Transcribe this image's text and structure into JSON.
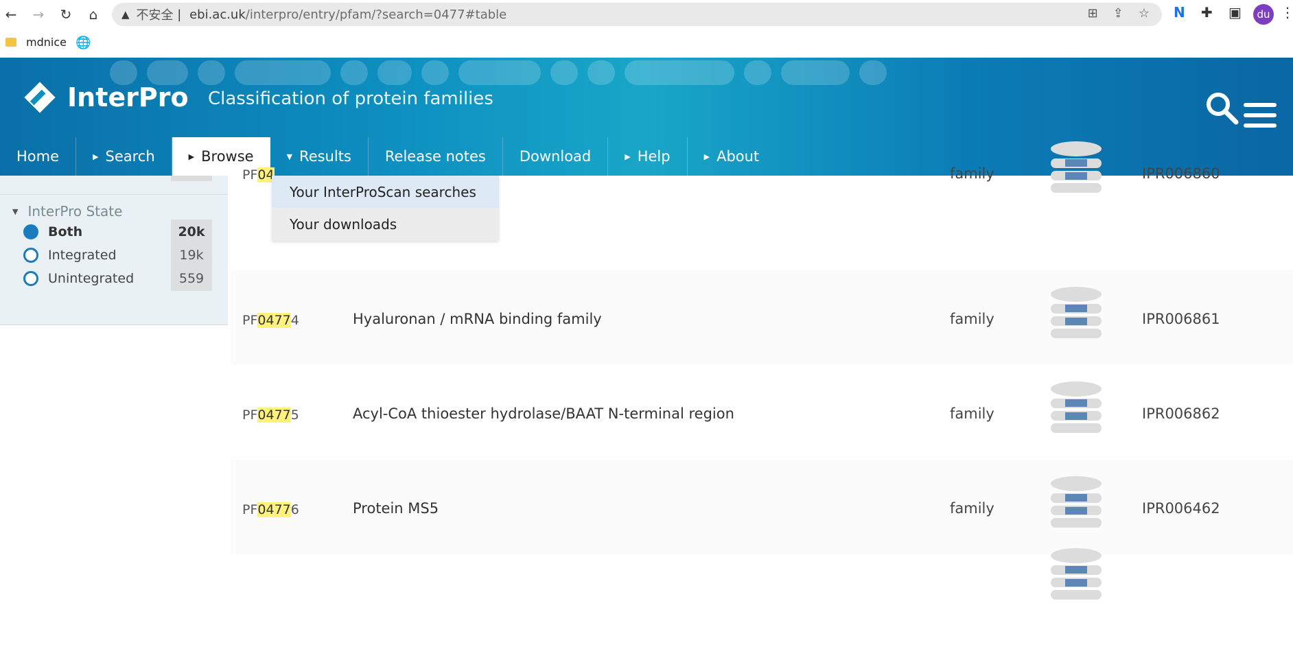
{
  "browser": {
    "url_insecure_label": "不安全",
    "url_host": "ebi.ac.uk",
    "url_rest": "/interpro/entry/pfam/?search=0477#table",
    "avatar_initials": "du",
    "bookmarks": [
      {
        "label": "mdnice"
      }
    ]
  },
  "header": {
    "logo_text": "InterPro",
    "tagline": "Classification of protein families",
    "nav": [
      {
        "label": "Home",
        "has_arrow": false
      },
      {
        "label": "Search",
        "has_arrow": true
      },
      {
        "label": "Browse",
        "has_arrow": true,
        "active": true
      },
      {
        "label": "Results",
        "has_arrow": true,
        "open": true
      },
      {
        "label": "Release notes",
        "has_arrow": false
      },
      {
        "label": "Download",
        "has_arrow": false
      },
      {
        "label": "Help",
        "has_arrow": true
      },
      {
        "label": "About",
        "has_arrow": true
      }
    ]
  },
  "results_menu": {
    "items": [
      "Your InterProScan searches",
      "Your downloads"
    ]
  },
  "sidebar": {
    "section_title": "InterPro State",
    "options": [
      {
        "label": "Both",
        "count": "20k",
        "selected": true
      },
      {
        "label": "Integrated",
        "count": "19k",
        "selected": false
      },
      {
        "label": "Unintegrated",
        "count": "559",
        "selected": false
      }
    ]
  },
  "table": {
    "search_highlight": "0477",
    "rows": [
      {
        "acc_prefix": "PF",
        "acc_match": "04",
        "acc_suffix": "",
        "name": "",
        "type": "family",
        "integrated": "IPR006860"
      },
      {
        "acc_prefix": "PF",
        "acc_match": "0477",
        "acc_suffix": "4",
        "name": "Hyaluronan / mRNA binding family",
        "type": "family",
        "integrated": "IPR006861"
      },
      {
        "acc_prefix": "PF",
        "acc_match": "0477",
        "acc_suffix": "5",
        "name": "Acyl-CoA thioester hydrolase/BAAT N-terminal region",
        "type": "family",
        "integrated": "IPR006862"
      },
      {
        "acc_prefix": "PF",
        "acc_match": "0477",
        "acc_suffix": "6",
        "name": "Protein MS5",
        "type": "family",
        "integrated": "IPR006462"
      }
    ]
  },
  "colors": {
    "header_blue": "#0d8fc0",
    "highlight": "#fff27a",
    "radio_blue": "#1a7bbf"
  }
}
